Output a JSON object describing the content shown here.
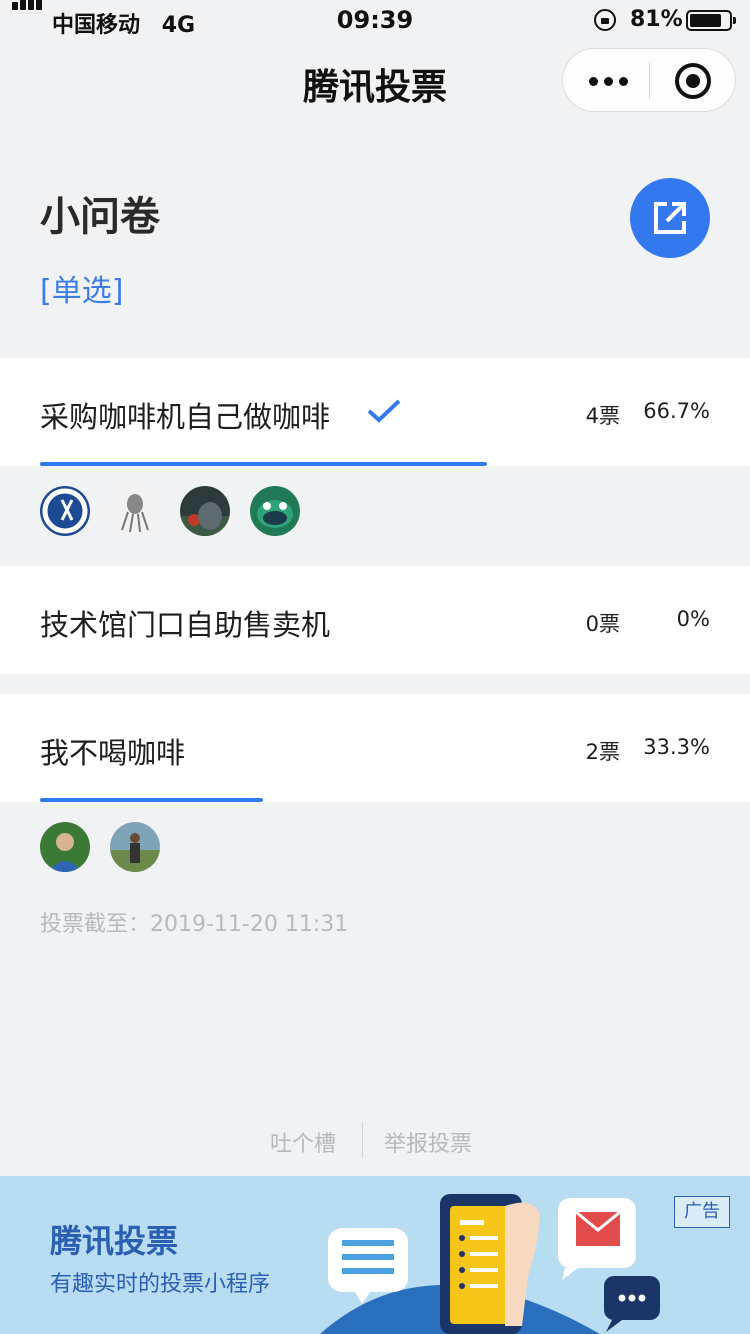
{
  "status_bar": {
    "carrier": "中国移动",
    "network": "4G",
    "time": "09:39",
    "battery_percent": "81%"
  },
  "nav": {
    "title": "腾讯投票"
  },
  "poll": {
    "title": "小问卷",
    "type": "[单选]",
    "options": [
      {
        "label": "采购咖啡机自己做咖啡",
        "votes": "4票",
        "percent": "66.7%",
        "share": 0.667,
        "selected": true
      },
      {
        "label": "技术馆门口自助售卖机",
        "votes": "0票",
        "percent": "0%",
        "share": 0,
        "selected": false
      },
      {
        "label": "我不喝咖啡",
        "votes": "2票",
        "percent": "33.3%",
        "share": 0.333,
        "selected": false
      }
    ],
    "deadline": "投票截至：2019-11-20 11:31"
  },
  "footer": {
    "feedback": "吐个槽",
    "report": "举报投票"
  },
  "ad": {
    "title": "腾讯投票",
    "subtitle": "有趣实时的投票小程序",
    "badge": "广告"
  },
  "colors": {
    "accent": "#3478f0",
    "background": "#f1f2f4",
    "muted": "#b6b9bf",
    "ad_background": "#b8dcf1"
  }
}
